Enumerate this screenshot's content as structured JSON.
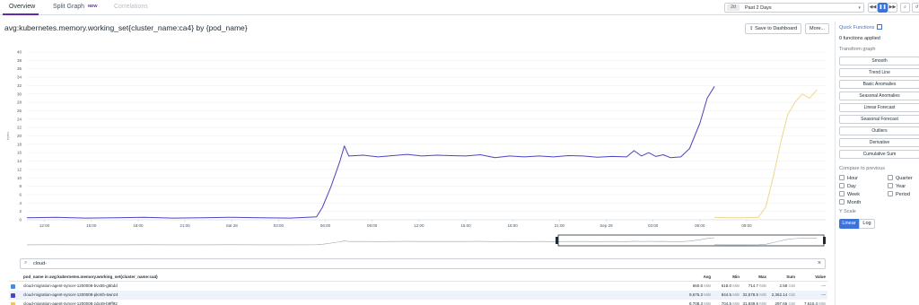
{
  "tabs": {
    "overview": "Overview",
    "split_graph": "Split Graph",
    "new_badge": "NEW",
    "correlations": "Correlations"
  },
  "time": {
    "chip": "2d",
    "label": "Past 2 Days"
  },
  "graph": {
    "title": "avg:kubernetes.memory.working_set{cluster_name:ca4} by {pod_name}",
    "save_label": "Save to Dashboard",
    "more_label": "More..."
  },
  "chart_data": {
    "type": "line",
    "ylabel": "bytes",
    "y_ticks": [
      "0",
      "2",
      "4",
      "6",
      "8",
      "10",
      "12",
      "14",
      "16",
      "18",
      "20",
      "22",
      "24",
      "26",
      "28",
      "30",
      "32",
      "34",
      "36",
      "38",
      "40"
    ],
    "ylim": [
      0,
      40
    ],
    "x_ticks": [
      "12:00",
      "15:00",
      "18:00",
      "21:00",
      "Sat 28",
      "03:00",
      "06:00",
      "09:00",
      "12:00",
      "15:00",
      "18:00",
      "21:00",
      "Sep 29",
      "03:00",
      "06:00",
      "09:00"
    ],
    "grid": true,
    "series": [
      {
        "name": "cloud-migration-agent-syncer-1200008-pkmth-6wnz4",
        "color": "#4e43c1",
        "points": [
          [
            0,
            0.5
          ],
          [
            2,
            0.6
          ],
          [
            4,
            0.4
          ],
          [
            6,
            0.5
          ],
          [
            8,
            0.6
          ],
          [
            10,
            0.4
          ],
          [
            12,
            0.5
          ],
          [
            14,
            0.6
          ],
          [
            16,
            0.5
          ],
          [
            18,
            0.4
          ],
          [
            19.8,
            0.7
          ],
          [
            20.2,
            3
          ],
          [
            20.8,
            8
          ],
          [
            21.4,
            14
          ],
          [
            21.7,
            17.6
          ],
          [
            22,
            15.2
          ],
          [
            23,
            15.4
          ],
          [
            24,
            15
          ],
          [
            25,
            15.3
          ],
          [
            26,
            15.6
          ],
          [
            27,
            15.2
          ],
          [
            28,
            15.4
          ],
          [
            29,
            15.3
          ],
          [
            30,
            15.2
          ],
          [
            31,
            15.5
          ],
          [
            32,
            14.8
          ],
          [
            33,
            15.2
          ],
          [
            34,
            15
          ],
          [
            35,
            15.2
          ],
          [
            36,
            15
          ],
          [
            37,
            15.3
          ],
          [
            38,
            15.2
          ],
          [
            39,
            14.9
          ],
          [
            40,
            15.1
          ],
          [
            41,
            15
          ],
          [
            41.5,
            16.5
          ],
          [
            42,
            15.2
          ],
          [
            42.5,
            16
          ],
          [
            43,
            15.1
          ],
          [
            43.5,
            15.5
          ],
          [
            44,
            14.8
          ],
          [
            44.7,
            15
          ],
          [
            45.3,
            17
          ],
          [
            46,
            23
          ],
          [
            46.5,
            29
          ],
          [
            47,
            31.8
          ]
        ]
      },
      {
        "name": "cloud-migration-agent-syncer-1200008-zdx49-b9ff92",
        "color": "#f0d68a",
        "points": [
          [
            47,
            0.6
          ],
          [
            48,
            0.5
          ],
          [
            49,
            0.5
          ],
          [
            50,
            0.6
          ],
          [
            50.5,
            3
          ],
          [
            51,
            10
          ],
          [
            51.5,
            18
          ],
          [
            52,
            25
          ],
          [
            52.5,
            28
          ],
          [
            53,
            30
          ],
          [
            53.5,
            29
          ],
          [
            54,
            31
          ]
        ]
      }
    ]
  },
  "search": {
    "value": "cloud-",
    "clear": "×"
  },
  "table": {
    "headers": {
      "name": "pod_name in avg:kubernetes.memory.working_set{cluster_name:ca4}",
      "avg": "Avg",
      "min": "Min",
      "max": "Max",
      "sum": "Sum",
      "value": "Value"
    },
    "rows": [
      {
        "color": "#3d8ee6",
        "name": "cloud-migration-agent-syncer-1200008-bvx55-g5bdd",
        "avg": "660.6",
        "avg_u": "MiB",
        "min": "618.0",
        "min_u": "MiB",
        "max": "714.7",
        "max_u": "MiB",
        "sum": "2.58",
        "sum_u": "GiB",
        "value": "—",
        "more": "···"
      },
      {
        "color": "#4e43c1",
        "name": "cloud-migration-agent-syncer-1200008-pkmth-6wnz4",
        "avg": "9,675.3",
        "avg_u": "MiB",
        "min": "844.5",
        "min_u": "MiB",
        "max": "32,578.5",
        "max_u": "MiB",
        "sum": "2,362.14",
        "sum_u": "GiB",
        "value": "—",
        "more": "···"
      },
      {
        "color": "#f0c948",
        "name": "cloud-migration-agent-syncer-1200008-zdx49-b9ff92",
        "avg": "8,708.3",
        "avg_u": "MiB",
        "min": "704.5",
        "min_u": "MiB",
        "max": "31,839.5",
        "max_u": "MiB",
        "sum": "297.65",
        "sum_u": "GiB",
        "value": "7,610.4",
        "value_u": "MiB",
        "more": "···"
      }
    ]
  },
  "panel": {
    "title": "Quick Functions",
    "applied": "0 functions applied",
    "transform_label": "Transform graph",
    "functions": [
      "Smooth",
      "Trend Line",
      "Basic Anomalies",
      "Seasonal Anomalies",
      "Linear Forecast",
      "Seasonal Forecast",
      "Outliers",
      "Derivative",
      "Cumulative Sum"
    ],
    "compare_label": "Compare to previous",
    "compare_left": [
      "Hour",
      "Day",
      "Week",
      "Month"
    ],
    "compare_right": [
      "Quarter",
      "Year",
      "Period"
    ],
    "yscale_label": "Y Scale",
    "linear": "Linear",
    "log": "Log"
  }
}
